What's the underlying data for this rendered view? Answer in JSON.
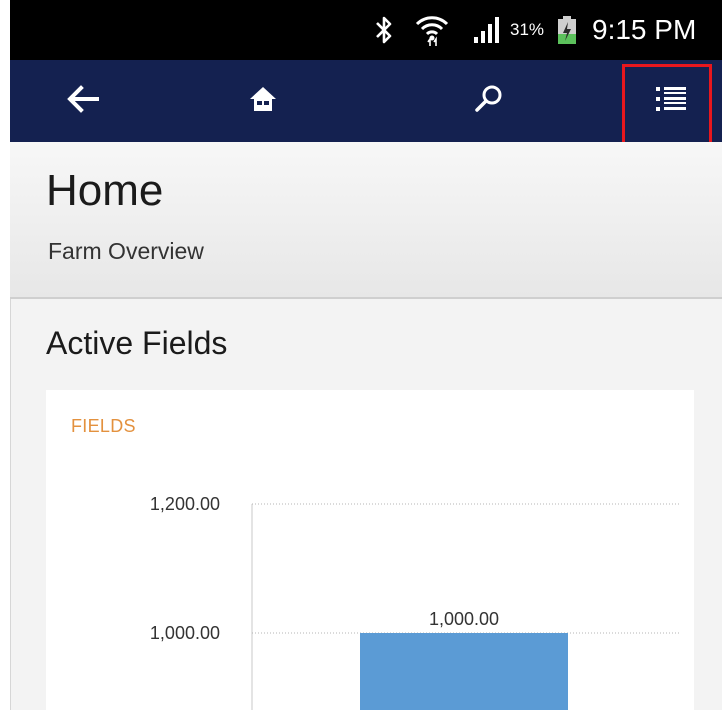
{
  "status_bar": {
    "battery_percent": "31%",
    "time": "9:15 PM",
    "icons": [
      "bluetooth-icon",
      "wifi-icon",
      "signal-icon",
      "battery-icon"
    ]
  },
  "toolbar": {
    "icons": [
      "back-arrow-icon",
      "home-icon",
      "search-icon",
      "list-menu-icon"
    ],
    "background_color": "#142150",
    "highlight_color": "#e8171d"
  },
  "header": {
    "title": "Home",
    "subtitle": "Farm Overview"
  },
  "section": {
    "title": "Active Fields"
  },
  "chart_data": {
    "type": "bar",
    "title": "FIELDS",
    "categories": [
      ""
    ],
    "values": [
      1000
    ],
    "data_labels": [
      "1,000.00"
    ],
    "y_ticks": [
      1200,
      1000
    ],
    "y_tick_labels": [
      "1,200.00",
      "1,000.00"
    ],
    "bar_color": "#5b9bd5",
    "title_color": "#e3913e",
    "grid": true
  }
}
